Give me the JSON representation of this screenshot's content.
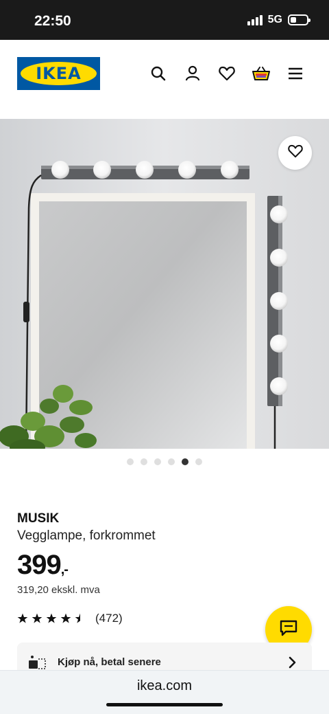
{
  "status_bar": {
    "time": "22:50",
    "network": "5G",
    "battery_level": 0.35
  },
  "header": {
    "logo_text": "IKEA",
    "icons": [
      "search-icon",
      "account-icon",
      "wishlist-heart-icon",
      "shopping-bag-icon",
      "menu-icon"
    ]
  },
  "gallery": {
    "image_count": 6,
    "active_index": 4,
    "favorite_icon": "heart-outline-icon"
  },
  "product": {
    "name": "MUSIK",
    "description": "Vegglampe, forkrommet",
    "price": "399",
    "price_suffix": ",-",
    "price_ex_vat": "319,20 ekskl. mva",
    "rating": 4.5,
    "rating_count": "(472)"
  },
  "payment": {
    "label": "Kjøp nå, betal senere"
  },
  "browser": {
    "url": "ikea.com"
  },
  "colors": {
    "brand_blue": "#0058a3",
    "brand_yellow": "#ffdb00"
  }
}
